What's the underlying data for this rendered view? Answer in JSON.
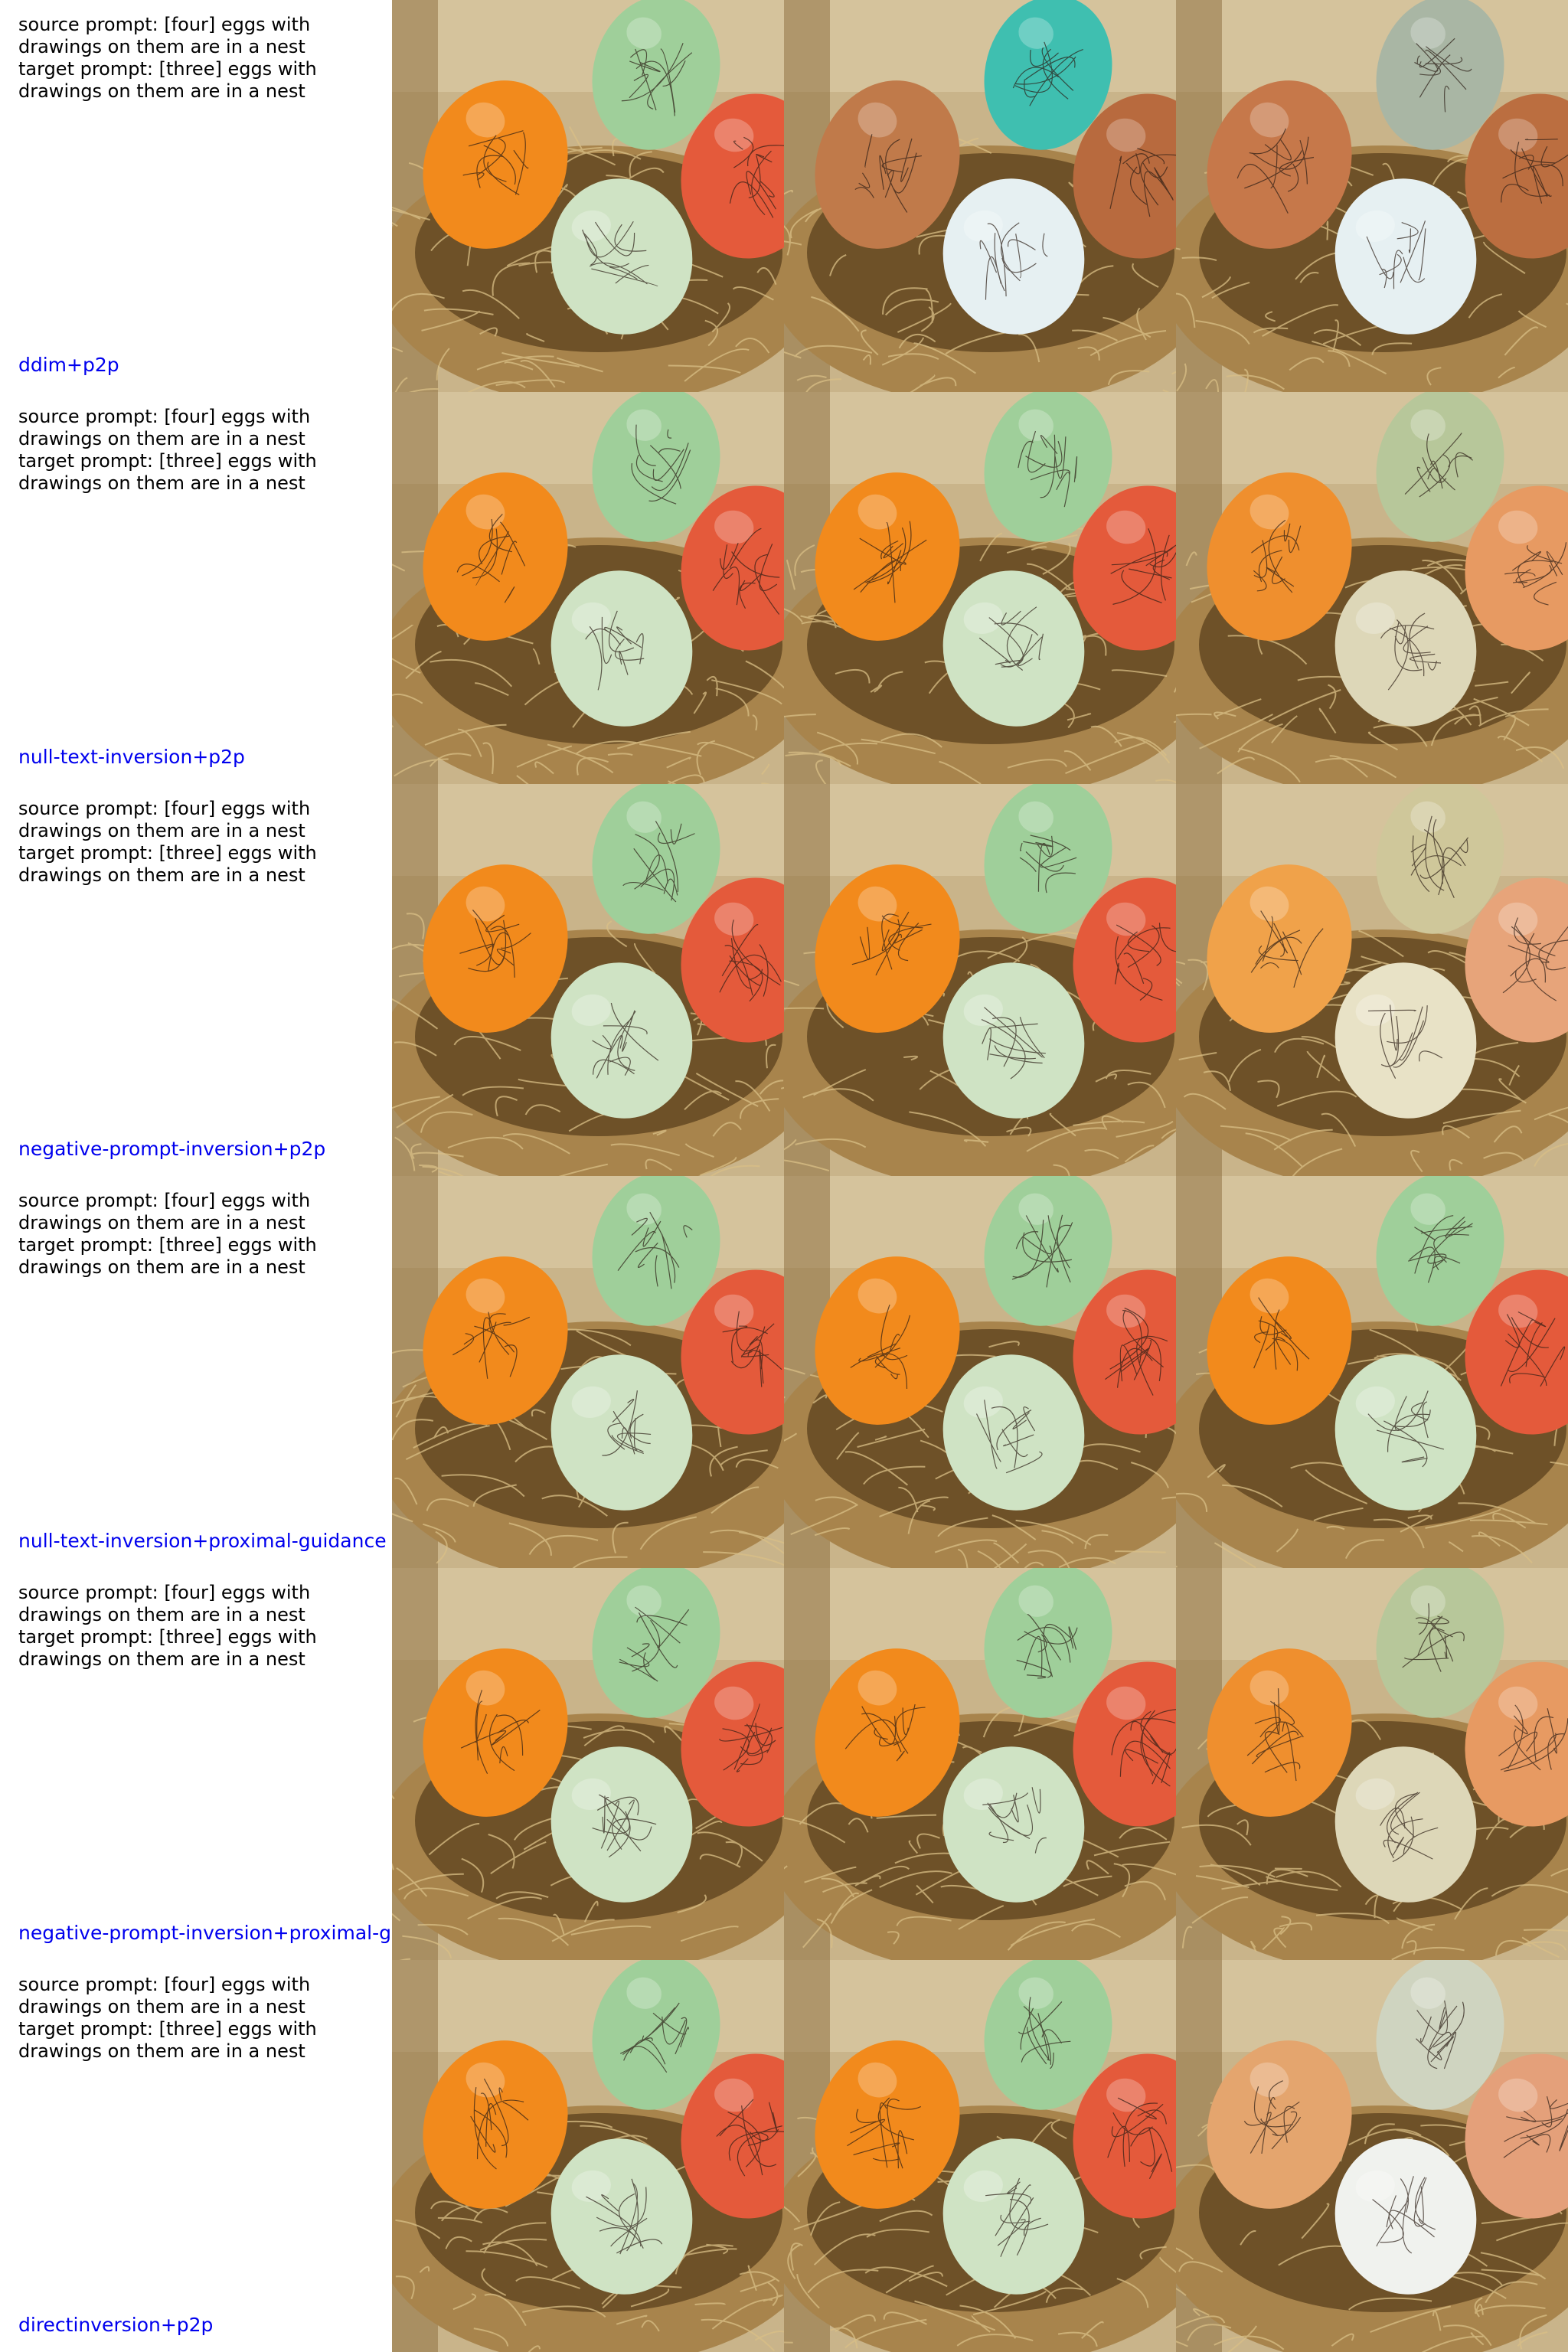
{
  "rows": [
    {
      "source_prompt": "source prompt: [four] eggs with drawings on them are in a nest",
      "target_prompt": "target prompt: [three] eggs with drawings on them are in a nest",
      "method": "ddim+p2p"
    },
    {
      "source_prompt": "source prompt: [four] eggs with drawings on them are in a nest",
      "target_prompt": "target prompt: [three] eggs with drawings on them are in a nest",
      "method": "null-text-inversion+p2p"
    },
    {
      "source_prompt": "source prompt: [four] eggs with drawings on them are in a nest",
      "target_prompt": "target prompt: [three] eggs with drawings on them are in a nest",
      "method": "negative-prompt-inversion+p2p"
    },
    {
      "source_prompt": "source prompt: [four] eggs with drawings on them are in a nest",
      "target_prompt": "target prompt: [three] eggs with drawings on them are in a nest",
      "method": "null-text-inversion+proximal-guidance"
    },
    {
      "source_prompt": "source prompt: [four] eggs with drawings on them are in a nest",
      "target_prompt": "target prompt: [three] eggs with drawings on them are in a nest",
      "method": "negative-prompt-inversion+proximal-guidance"
    },
    {
      "source_prompt": "source prompt: [four] eggs with drawings on them are in a nest",
      "target_prompt": "target prompt: [three] eggs with drawings on them are in a nest",
      "method": "directinversion+p2p"
    }
  ],
  "colors": {
    "method_label": "#0000ee",
    "prompt_text": "#000000",
    "background": "#ffffff",
    "nest_straw": "#b08a52",
    "egg_orange": "#f28a1c",
    "egg_green": "#9fcf9a",
    "egg_red": "#e45a3b",
    "egg_pale_green": "#cfe3c4",
    "egg_brown": "#c07a4a",
    "egg_teal": "#3fbfb0",
    "egg_white": "#e6f0f2"
  }
}
